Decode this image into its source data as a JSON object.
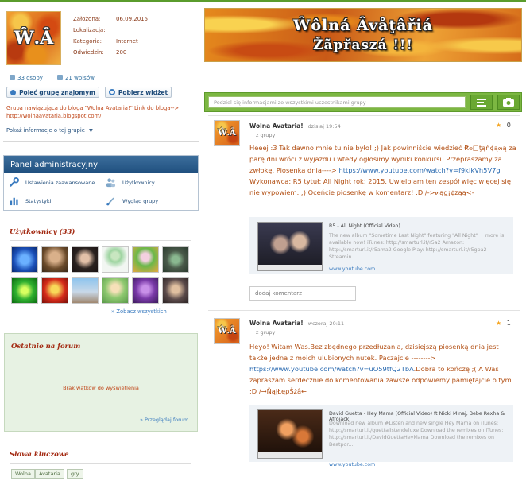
{
  "group": {
    "avatar_text": "Ŵ.Â",
    "info": [
      {
        "label": "Założona:",
        "value": "06.09.2015"
      },
      {
        "label": "Lokalizacja:",
        "value": ""
      },
      {
        "label": "Kategoria:",
        "value": "Internet"
      },
      {
        "label": "Odwiedzin:",
        "value": "200"
      }
    ],
    "members": "33 osoby",
    "posts": "21 wpisów",
    "recommend_button": "Poleć grupę znajomym",
    "widget_button": "Pobierz widżet",
    "blog_text": "Grupa nawiązująca do bloga \"Wolna Avataria!\" Link do bloga-->",
    "blog_url": "http://wolnaavataria.blogspot.com/",
    "show_info": "Pokaż informacje o tej grupie"
  },
  "admin_panel": {
    "title": "Panel administracyjny",
    "items": [
      "Ustawienia zaawansowane",
      "Użytkownicy",
      "Statystyki",
      "Wygląd grupy"
    ]
  },
  "users": {
    "title": "Użytkownicy (33)",
    "see_all": "» Zobacz wszystkich"
  },
  "forum": {
    "title": "Ostatnio na forum",
    "empty": "Brak wątków do wyświetlenia",
    "link": "» Przeglądaj forum"
  },
  "keywords": {
    "title": "Słowa kluczowe",
    "tags": [
      "Wolna",
      "Avataria",
      "gry"
    ]
  },
  "banner": {
    "line1": "Ŵôlná Âvåţâřiá",
    "line2": "Žãpřaszá !!!"
  },
  "post_box": {
    "placeholder": "Podziel się informacjami ze wszystkimi uczestnikami grupy"
  },
  "posts": [
    {
      "author": "Wolna Avataria!",
      "date": "dzisiaj 19:54",
      "group": "z grupy",
      "likes": "0",
      "text_before": "Heeej :3 Tak dawno mnie tu nie było! ;) Jak powinniście wiedzieć Ꞧ๏□ţąń¢ą๓ą za parę dni wróci z wyjazdu i wtedy ogłosimy wyniki konkursu.Przepraszamy za zwłokę. Piosenka dnia---->",
      "url": "https://www.youtube.com/watch?v=f9kIkVh5V7g",
      "text_after": "Wykonawca: R5 tytuł: All Night rok: 2015. Uwielbiam ten zespół więc więcej się nie wypowiem. ;) Oceńcie piosenkę w komentarz! :D /->๓ąǥ¡¢ząą<-",
      "embed": {
        "title": "R5 - All Night (Official Video)",
        "desc": "The new album \"Sometime Last Night\" featuring \"All Night\" + more is available now! iTunes: http://smarturl.it/r5a2 Amazon: http://smarturl.it/r5ama2 Google Play: http://smarturl.it/r5gpa2 Streamin...",
        "source": "www.youtube.com"
      }
    },
    {
      "author": "Wolna Avataria!",
      "date": "wczoraj 20:11",
      "group": "z grupy",
      "likes": "1",
      "text_before": "Heyo! Witam Was.Bez zbędnego przedłużania, dzisiejszą piosenką dnia jest także jedna z moich ulubionych nutek. Paczajcie -------->",
      "url": "https://www.youtube.com/watch?v=uO59tfQ2TbA",
      "text_after": ".Dobra to kończę ;( A Was zapraszam serdecznie do komentowania zawsze odpowiemy pamiętajcie o tym ;D /→ÑąĮŁęρŠżâ←",
      "embed": {
        "title": "David Guetta - Hey Mama (Official Video) ft Nicki Minaj, Bebe Rexha & Afrojack",
        "desc": "Download new album #Listen and new single Hey Mama on iTunes: http://smarturl.it/guettalistendeluxe Download the remixes on iTunes: http://smarturl.it/DavidGuettaHeyMama Download the remixes on Beatpor...",
        "source": "www.youtube.com"
      }
    }
  ],
  "comment_placeholder": "dodaj komentarz",
  "colors": {
    "accent_green": "#7cb742",
    "panel_blue": "#1f4f7e",
    "post_text": "#b24e12",
    "link": "#2a6ab0"
  }
}
